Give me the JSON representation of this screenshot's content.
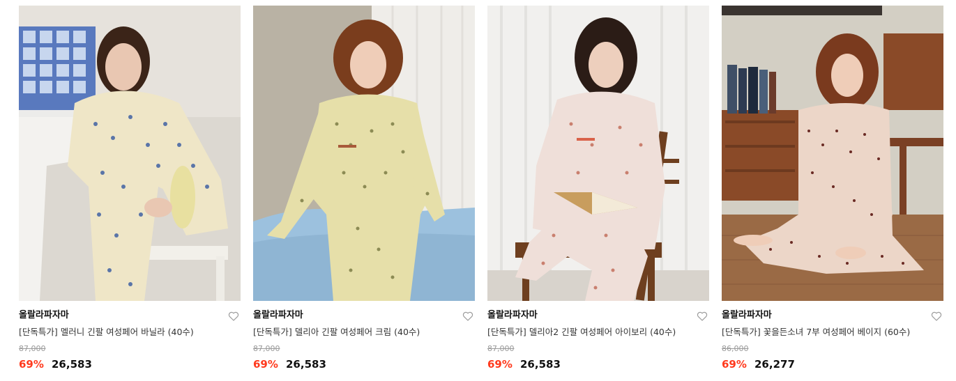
{
  "products": [
    {
      "brand": "올랄라파자마",
      "title": "[단독특가] 멜러니 긴팔 여성페어 바닐라 (40수)",
      "original_price": "87,000",
      "discount": "69%",
      "price": "26,583",
      "image_label": "product-photo-vanilla-floral-pajama",
      "colors": {
        "bg": "#d9d6d1",
        "wall": "#e8e5df",
        "tile": "#3f66b8",
        "garment": "#efe6c7",
        "pattern": "#5a75a8",
        "hair": "#3b2418",
        "skin": "#e9c7b2",
        "stool": "#f2f0ea"
      }
    },
    {
      "brand": "올랄라파자마",
      "title": "[단독특가] 델리아 긴팔 여성페어 크림 (40수)",
      "original_price": "87,000",
      "discount": "69%",
      "price": "26,583",
      "image_label": "product-photo-cream-floral-pajama",
      "colors": {
        "bg": "#c9c2b4",
        "wall": "#d8d2c6",
        "curtain": "#eeece8",
        "garment": "#e6dfa9",
        "pattern": "#8c8b54",
        "hair": "#7a3d1d",
        "skin": "#efcdb8",
        "bed": "#9cc1de"
      }
    },
    {
      "brand": "올랄라파자마",
      "title": "[단독특가] 델리아2 긴팔 여성페어 아이보리 (40수)",
      "original_price": "87,000",
      "discount": "69%",
      "price": "26,583",
      "image_label": "product-photo-ivory-floral-pajama",
      "colors": {
        "bg": "#ecebe8",
        "wall": "#f4f3f1",
        "curtain": "#f8f8f7",
        "garment": "#efdfd9",
        "pattern": "#c97f6e",
        "hair": "#2b1c16",
        "skin": "#edcfbd",
        "chair": "#6e3f1f"
      }
    },
    {
      "brand": "올랄라파자마",
      "title": "[단독특가] 꽃을든소녀 7부 여성페어 베이지 (60수)",
      "original_price": "86,000",
      "discount": "69%",
      "price": "26,277",
      "image_label": "product-photo-beige-dot-pajama",
      "colors": {
        "bg": "#d8d4c9",
        "wall": "#cfcbc0",
        "furniture": "#8a4a28",
        "floor": "#9a6a45",
        "garment": "#ecd6c8",
        "pattern": "#6a2a24",
        "hair": "#7a3a1e",
        "skin": "#efcdb8",
        "books": "#3f4f66"
      }
    }
  ]
}
